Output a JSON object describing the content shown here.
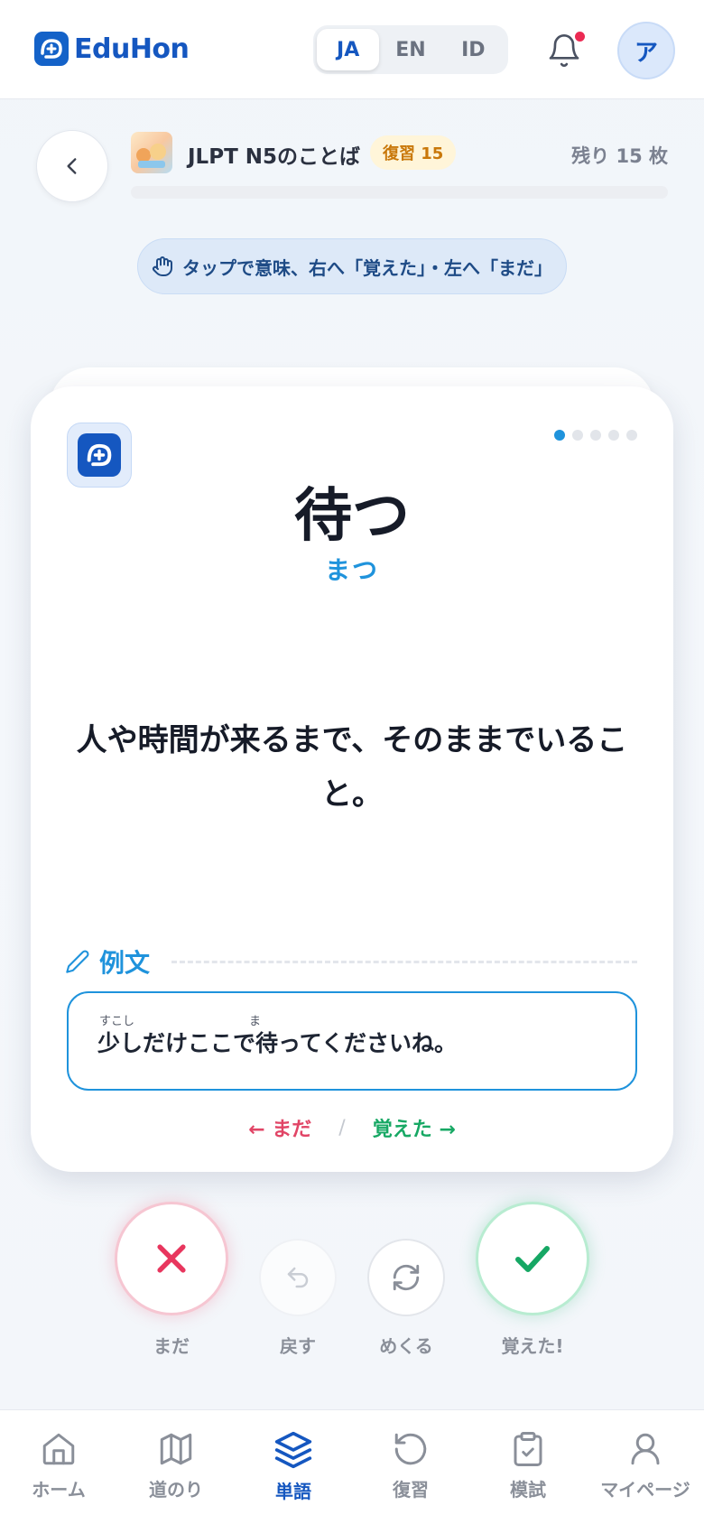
{
  "header": {
    "logo_text": "EduHon",
    "languages": [
      "JA",
      "EN",
      "ID"
    ],
    "active_language": "JA",
    "avatar_initial": "ア"
  },
  "deck": {
    "title": "JLPT N5のことば",
    "review_badge": "復習 15",
    "remaining": "残り 15 枚",
    "progress": 0
  },
  "hint": "タップで意味、右へ「覚えた」・左へ「まだ」",
  "card": {
    "word": "待つ",
    "reading": "まつ",
    "meaning": "人や時間が来るまで、そのままでいること。",
    "example_label": "例文",
    "example_sentence": "少しだけここで待ってくださいね。",
    "ruby_1": "すこし",
    "ruby_2": "ま",
    "swipe_not": "← まだ",
    "swipe_sep": "/",
    "swipe_yes": "覚えた →",
    "page_dots": 5,
    "active_dot": 1
  },
  "actions": {
    "not_yet": "まだ",
    "undo": "戻す",
    "flip": "めくる",
    "got_it": "覚えた!"
  },
  "nav": [
    {
      "label": "ホーム",
      "icon": "home-icon"
    },
    {
      "label": "道のり",
      "icon": "map-icon"
    },
    {
      "label": "単語",
      "icon": "layers-icon",
      "active": true
    },
    {
      "label": "復習",
      "icon": "history-icon"
    },
    {
      "label": "模試",
      "icon": "clipboard-check-icon"
    },
    {
      "label": "マイページ",
      "icon": "user-icon"
    }
  ],
  "colors": {
    "brand": "#1557c0",
    "accent": "#1f93dc",
    "not_yet": "#e14566",
    "got_it": "#17a864",
    "notification": "#ec2a53"
  }
}
